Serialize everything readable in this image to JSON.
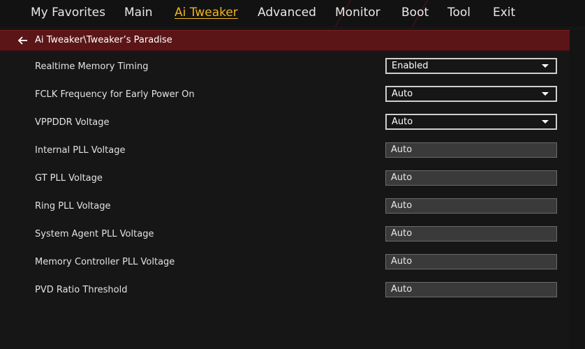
{
  "tabs": [
    {
      "label": "My Favorites",
      "active": false
    },
    {
      "label": "Main",
      "active": false
    },
    {
      "label": "Ai Tweaker",
      "active": true
    },
    {
      "label": "Advanced",
      "active": false
    },
    {
      "label": "Monitor",
      "active": false
    },
    {
      "label": "Boot",
      "active": false
    },
    {
      "label": "Tool",
      "active": false
    },
    {
      "label": "Exit",
      "active": false
    }
  ],
  "breadcrumb": {
    "icon": "back-arrow-icon",
    "text": "Ai Tweaker\\Tweaker’s Paradise"
  },
  "settings": [
    {
      "label": "Realtime Memory Timing",
      "value": "Enabled",
      "control": "dropdown"
    },
    {
      "label": "FCLK Frequency for Early Power On",
      "value": "Auto",
      "control": "dropdown"
    },
    {
      "label": "VPPDDR Voltage",
      "value": "Auto",
      "control": "dropdown"
    },
    {
      "label": "Internal PLL Voltage",
      "value": "Auto",
      "control": "field"
    },
    {
      "label": "GT PLL Voltage",
      "value": "Auto",
      "control": "field"
    },
    {
      "label": "Ring PLL Voltage",
      "value": "Auto",
      "control": "field"
    },
    {
      "label": "System Agent PLL Voltage",
      "value": "Auto",
      "control": "field"
    },
    {
      "label": "Memory Controller PLL Voltage",
      "value": "Auto",
      "control": "field"
    },
    {
      "label": "PVD Ratio Threshold",
      "value": "Auto",
      "control": "field"
    }
  ],
  "colors": {
    "active_tab": "#f2b51b",
    "breadcrumb_bar": "#5c1517",
    "background": "#161616"
  }
}
